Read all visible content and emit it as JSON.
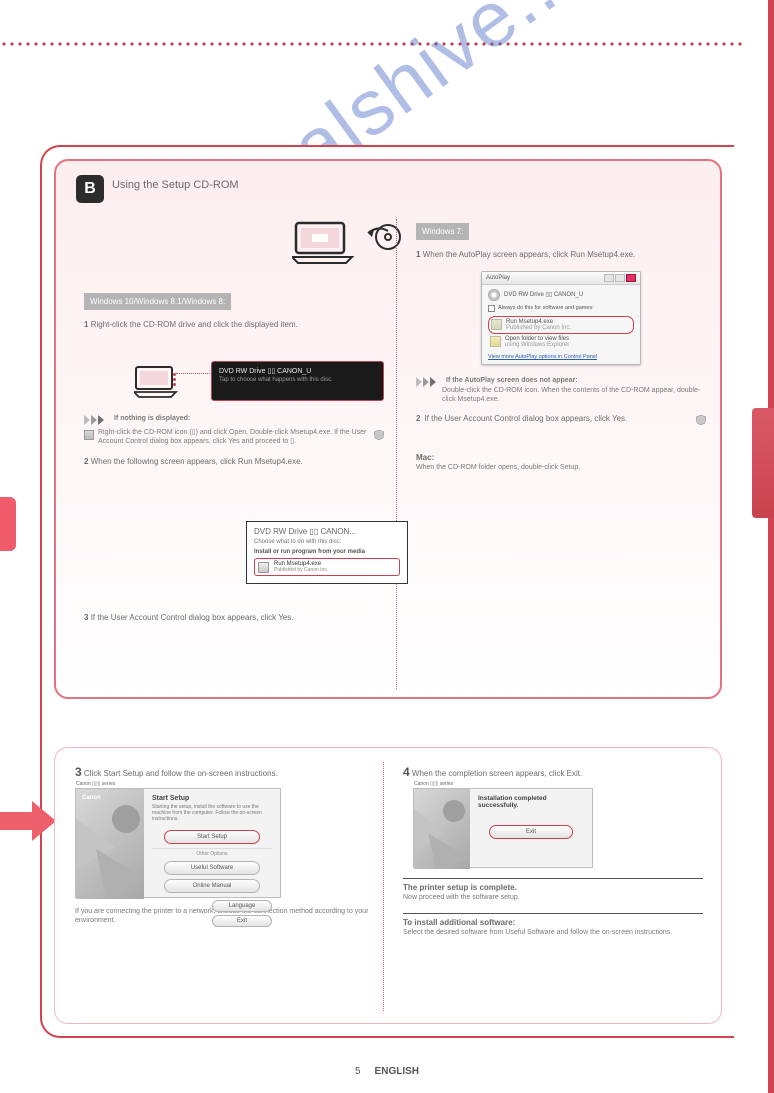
{
  "sectionB": {
    "badge": "B",
    "title": "Using the Setup CD-ROM",
    "win10": {
      "heading": "Windows 10/Windows 8.1/Windows 8:",
      "step1_num": "1",
      "step1_text": "Right-click the CD-ROM drive and click the displayed item.",
      "toast": {
        "line1": "DVD RW Drive ▯▯ CANON_U",
        "line2": "Tap to choose what happens with this disc."
      },
      "noteA_lead": "If nothing is displayed:",
      "noteA_text": "Right-click the CD-ROM icon (▯) and click Open. Double-click Msetup4.exe. If the User Account Control dialog box appears, click Yes and proceed to ▯.",
      "step2_num": "2",
      "step2_text": "When the following screen appears, click Run Msetup4.exe.",
      "mini": {
        "title": "DVD RW Drive ▯▯ CANON...",
        "sub": "Choose what to do with this disc.",
        "header": "Install or run program from your media",
        "row_t1": "Run Msetup4.exe",
        "row_t2": "Published by Canon Inc."
      },
      "step3_num": "3",
      "step3_text": "If the User Account Control dialog box appears, click Yes."
    },
    "win7": {
      "heading": "Windows 7:",
      "step1_num": "1",
      "step1_text": "When the AutoPlay screen appears, click Run Msetup4.exe.",
      "dialog": {
        "tbar": "AutoPlay",
        "drive": "DVD RW Drive ▯▯ CANON_U",
        "chk": "Always do this for software and games:",
        "opt_hi_t1": "Run Msetup4.exe",
        "opt_hi_t2": "Published by Canon Inc.",
        "opt2_t1": "Open folder to view files",
        "opt2_t2": "using Windows Explorer",
        "link": "View more AutoPlay options in Control Panel"
      },
      "noteA_lead": "If the AutoPlay screen does not appear:",
      "noteA_text": "Double-click the CD-ROM icon. When the contents of the CD-ROM appear, double-click Msetup4.exe.",
      "step2_num": "2",
      "step2_text": "If the User Account Control dialog box appears, click Yes.",
      "mac_lead": "Mac:",
      "mac_text": "When the CD-ROM folder opens, double-click Setup."
    }
  },
  "sectionC": {
    "left": {
      "num": "3",
      "text": "Click Start Setup and follow the on-screen instructions.",
      "wiz": {
        "bar": "Canon ▯▯▯ series",
        "logo": "Canon",
        "h": "Start Setup",
        "d": "Starting the setup, install the software to use the machine from the computer. Follow the on-screen instructions.",
        "btn_hi": "Start Setup",
        "sep_label": "Other Options",
        "btn2": "Useful Software",
        "btn3": "Online Manual",
        "btn_small1": "Language",
        "btn_small2": "Exit"
      },
      "note": "If you are connecting the printer to a network, choose the connection method according to your environment."
    },
    "right": {
      "num": "4",
      "text": "When the completion screen appears, click Exit.",
      "wiz": {
        "bar": "Canon ▯▯▯ series",
        "h": "Installation completed successfully.",
        "btn_hi": "Exit"
      },
      "done_head": "The printer setup is complete.",
      "done_sub": "Now proceed with the software setup.",
      "inst_head": "To install additional software:",
      "inst_body": "Select the desired software from Useful Software and follow the on-screen instructions."
    }
  },
  "watermark": "manualshive..com",
  "page": {
    "num": "5",
    "lang": "ENGLISH"
  }
}
